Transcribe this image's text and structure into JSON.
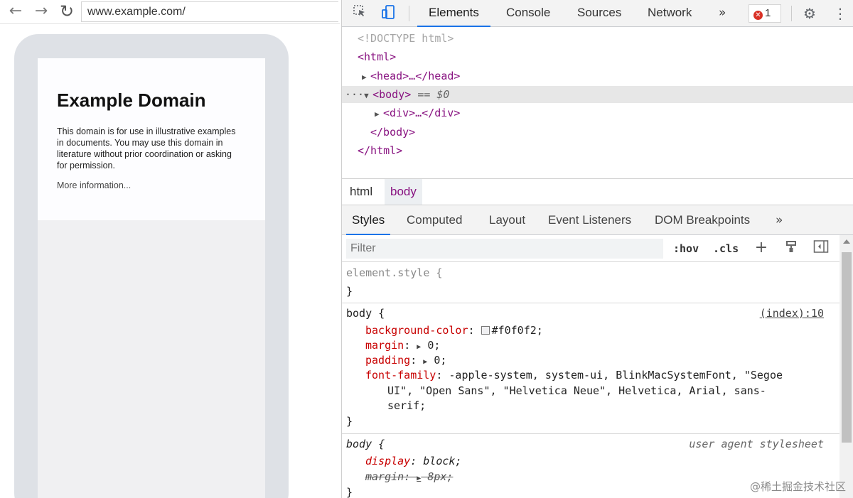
{
  "browser": {
    "url": "www.example.com/",
    "icons": {
      "back": "back-arrow-icon",
      "forward": "forward-arrow-icon",
      "reload": "reload-icon"
    },
    "page": {
      "heading": "Example Domain",
      "description": "This domain is for use in illustrative examples in documents. You may use this domain in literature without prior coordination or asking for permission.",
      "link": "More information..."
    }
  },
  "devtools": {
    "tabs": [
      "Elements",
      "Console",
      "Sources",
      "Network"
    ],
    "more_tabs": "»",
    "active_tab": "Elements",
    "error_count": "1",
    "dom": {
      "doctype": "<!DOCTYPE html>",
      "html_open": "<html>",
      "head": "<head>…</head>",
      "body_open": "<body>",
      "body_eq": "== $0",
      "div": "<div>…</div>",
      "body_close": "</body>",
      "html_close": "</html>",
      "dots": "···"
    },
    "breadcrumbs": [
      "html",
      "body"
    ],
    "subtabs": [
      "Styles",
      "Computed",
      "Layout",
      "Event Listeners",
      "DOM Breakpoints"
    ],
    "subtabs_more": "»",
    "filter_placeholder": "Filter",
    "hov": ":hov",
    "cls": ".cls",
    "styles": {
      "element_style_open": "element.style {",
      "close": "}",
      "body_open": "body {",
      "body_source": "(index):10",
      "background_prop": "background-color",
      "background_val": "#f0f0f2;",
      "background_swatch": "#f0f0f2",
      "margin_prop": "margin",
      "margin_val": "0;",
      "padding_prop": "padding",
      "padding_val": "0;",
      "font_prop": "font-family",
      "font_val_1": "-apple-system, system-ui, BlinkMacSystemFont, \"Segoe",
      "font_val_2": "UI\", \"Open Sans\", \"Helvetica Neue\", Helvetica, Arial, sans-",
      "font_val_3": "serif;",
      "ua_body_open": "body {",
      "ua_source": "user agent stylesheet",
      "display_prop": "display",
      "display_val": "block;",
      "ua_margin_prop": "margin",
      "ua_margin_val": "8px;"
    }
  },
  "watermark": "@稀土掘金技术社区",
  "colors": {
    "accent": "#1a73e8",
    "tag": "#881280",
    "property": "#c80000",
    "error": "#d93025"
  }
}
